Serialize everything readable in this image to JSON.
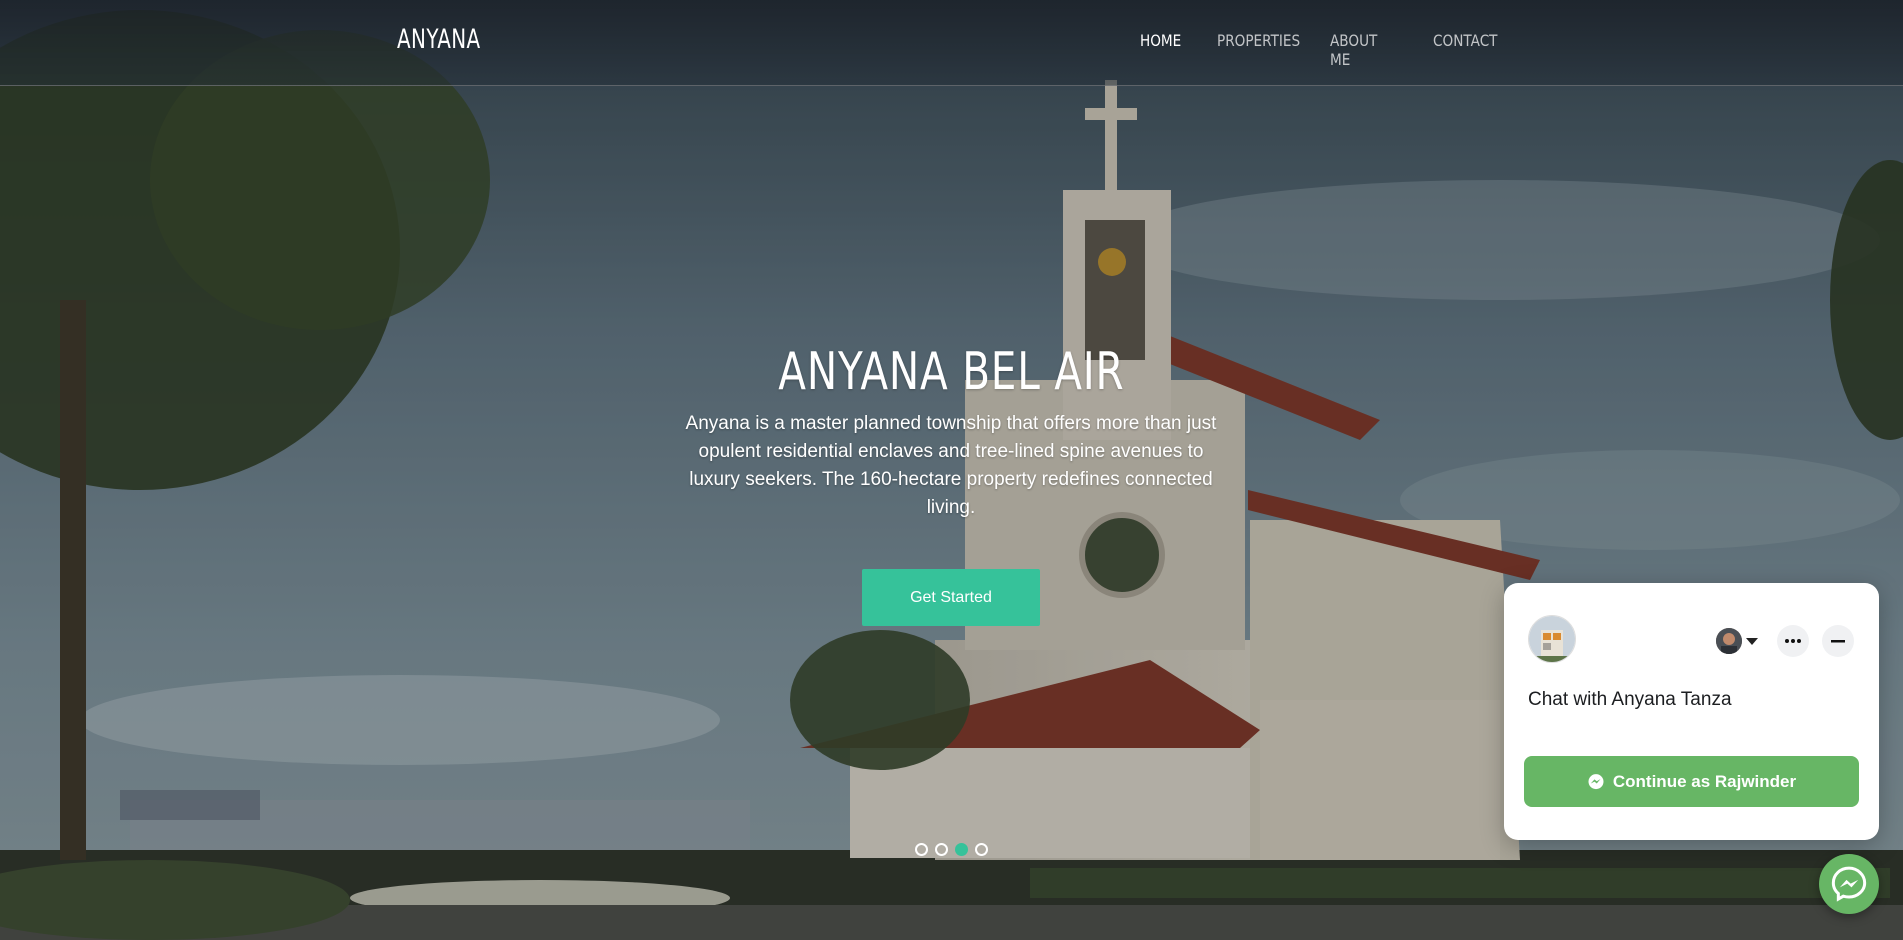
{
  "header": {
    "logo": "ANYANA",
    "nav": [
      {
        "label": "HOME",
        "active": true
      },
      {
        "label": "PROPERTIES",
        "active": false
      },
      {
        "label": "ABOUT ME",
        "active": false
      },
      {
        "label": "CONTACT",
        "active": false
      }
    ]
  },
  "hero": {
    "title": "ANYANA BEL AIR",
    "description": "Anyana is a master planned township that offers more than just opulent residential enclaves and tree-lined spine avenues to luxury seekers. The 160-hectare property redefines connected living.",
    "cta_label": "Get Started",
    "slides_count": 4,
    "active_slide": 3
  },
  "chat_widget": {
    "title": "Chat with Anyana Tanza",
    "continue_label": "Continue as Rajwinder",
    "icons": [
      "page-avatar",
      "user-avatar",
      "chevron-down-icon",
      "more-icon",
      "minimize-icon",
      "messenger-icon"
    ]
  },
  "colors": {
    "accent": "#36c29a",
    "chat_green": "#67b665",
    "header_bg": "#1f262e"
  }
}
